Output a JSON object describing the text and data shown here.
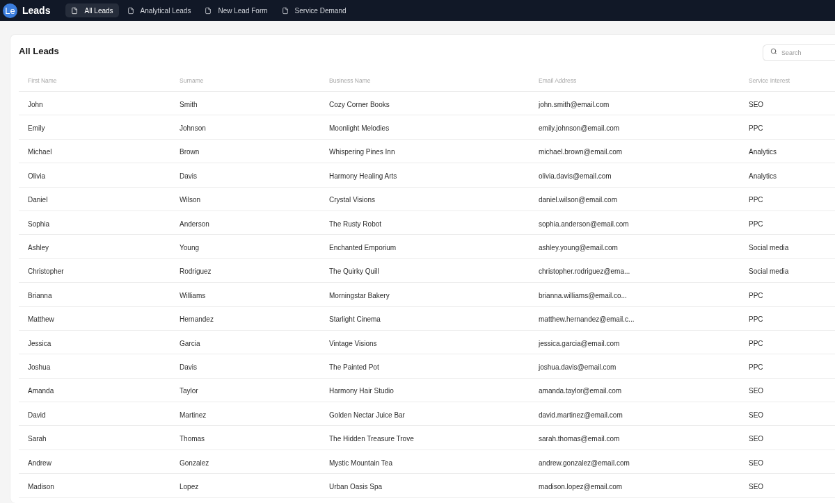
{
  "nav": {
    "logo": "Le",
    "title": "Leads",
    "tabs": [
      {
        "label": "All Leads",
        "selected": true
      },
      {
        "label": "Analytical Leads",
        "selected": false
      },
      {
        "label": "New Lead Form",
        "selected": false
      },
      {
        "label": "Service Demand",
        "selected": false
      }
    ]
  },
  "page": {
    "title": "All Leads",
    "search": {
      "placeholder": "Search"
    }
  },
  "table": {
    "columns": [
      "First Name",
      "Surname",
      "Business Name",
      "Email Address",
      "Service Interest"
    ],
    "rows": [
      [
        "John",
        "Smith",
        "Cozy Corner Books",
        "john.smith@email.com",
        "SEO"
      ],
      [
        "Emily",
        "Johnson",
        "Moonlight Melodies",
        "emily.johnson@email.com",
        "PPC"
      ],
      [
        "Michael",
        "Brown",
        "Whispering Pines Inn",
        "michael.brown@email.com",
        "Analytics"
      ],
      [
        "Olivia",
        "Davis",
        "Harmony Healing Arts",
        "olivia.davis@email.com",
        "Analytics"
      ],
      [
        "Daniel",
        "Wilson",
        "Crystal Visions",
        "daniel.wilson@email.com",
        "PPC"
      ],
      [
        "Sophia",
        "Anderson",
        "The Rusty Robot",
        "sophia.anderson@email.com",
        "PPC"
      ],
      [
        "Ashley",
        "Young",
        "Enchanted Emporium",
        "ashley.young@email.com",
        "Social media"
      ],
      [
        "Christopher",
        "Rodriguez",
        "The Quirky Quill",
        "christopher.rodriguez@ema...",
        "Social media"
      ],
      [
        "Brianna",
        "Williams",
        "Morningstar Bakery",
        "brianna.williams@email.co...",
        "PPC"
      ],
      [
        "Matthew",
        "Hernandez",
        "Starlight Cinema",
        "matthew.hernandez@email.c...",
        "PPC"
      ],
      [
        "Jessica",
        "Garcia",
        "Vintage Visions",
        "jessica.garcia@email.com",
        "PPC"
      ],
      [
        "Joshua",
        "Davis",
        "The Painted Pot",
        "joshua.davis@email.com",
        "PPC"
      ],
      [
        "Amanda",
        "Taylor",
        "Harmony Hair Studio",
        "amanda.taylor@email.com",
        "SEO"
      ],
      [
        "David",
        "Martinez",
        "Golden Nectar Juice Bar",
        "david.martinez@email.com",
        "SEO"
      ],
      [
        "Sarah",
        "Thomas",
        "The Hidden Treasure Trove",
        "sarah.thomas@email.com",
        "SEO"
      ],
      [
        "Andrew",
        "Gonzalez",
        "Mystic Mountain Tea",
        "andrew.gonzalez@email.com",
        "SEO"
      ],
      [
        "Madison",
        "Lopez",
        "Urban Oasis Spa",
        "madison.lopez@email.com",
        "SEO"
      ]
    ]
  }
}
